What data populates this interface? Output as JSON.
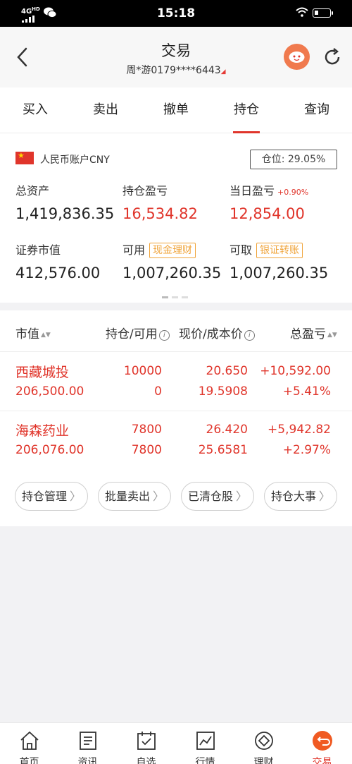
{
  "status_bar": {
    "network": "4G",
    "network_hd": "HD",
    "time": "15:18"
  },
  "header": {
    "title": "交易",
    "account": "周*游0179****6443"
  },
  "tabs": [
    {
      "label": "买入"
    },
    {
      "label": "卖出"
    },
    {
      "label": "撤单"
    },
    {
      "label": "持仓",
      "active": true
    },
    {
      "label": "查询"
    }
  ],
  "summary": {
    "account_name": "人民币账户CNY",
    "position_label": "仓位:",
    "position_value": "29.05%",
    "total_assets_label": "总资产",
    "total_assets": "1,419,836.35",
    "holding_pnl_label": "持仓盈亏",
    "holding_pnl": "16,534.82",
    "daily_pnl_label": "当日盈亏",
    "daily_pnl_pct": "+0.90%",
    "daily_pnl": "12,854.00",
    "market_value_label": "证券市值",
    "market_value": "412,576.00",
    "available_label": "可用",
    "available_chip": "现金理财",
    "available": "1,007,260.35",
    "withdrawable_label": "可取",
    "withdrawable_chip": "银证转账",
    "withdrawable": "1,007,260.35"
  },
  "holdings": {
    "columns": {
      "market_value": "市值",
      "position": "持仓/可用",
      "price": "现价/成本价",
      "pnl": "总盈亏"
    },
    "rows": [
      {
        "name": "西藏城投",
        "market_value": "206,500.00",
        "position": "10000",
        "available": "0",
        "price": "20.650",
        "cost": "19.5908",
        "pnl": "+10,592.00",
        "pnl_pct": "+5.41%"
      },
      {
        "name": "海森药业",
        "market_value": "206,076.00",
        "position": "7800",
        "available": "7800",
        "price": "26.420",
        "cost": "25.6581",
        "pnl": "+5,942.82",
        "pnl_pct": "+2.97%"
      }
    ],
    "actions": [
      {
        "label": "持仓管理"
      },
      {
        "label": "批量卖出"
      },
      {
        "label": "已清仓股"
      },
      {
        "label": "持仓大事"
      }
    ]
  },
  "bottom_nav": [
    {
      "label": "首页",
      "icon": "home-icon"
    },
    {
      "label": "资讯",
      "icon": "news-icon"
    },
    {
      "label": "自选",
      "icon": "watchlist-icon"
    },
    {
      "label": "行情",
      "icon": "market-icon"
    },
    {
      "label": "理财",
      "icon": "wealth-icon"
    },
    {
      "label": "交易",
      "icon": "trade-icon",
      "active": true
    }
  ],
  "colors": {
    "accent": "#e0352b",
    "chip": "#f0a43a"
  }
}
